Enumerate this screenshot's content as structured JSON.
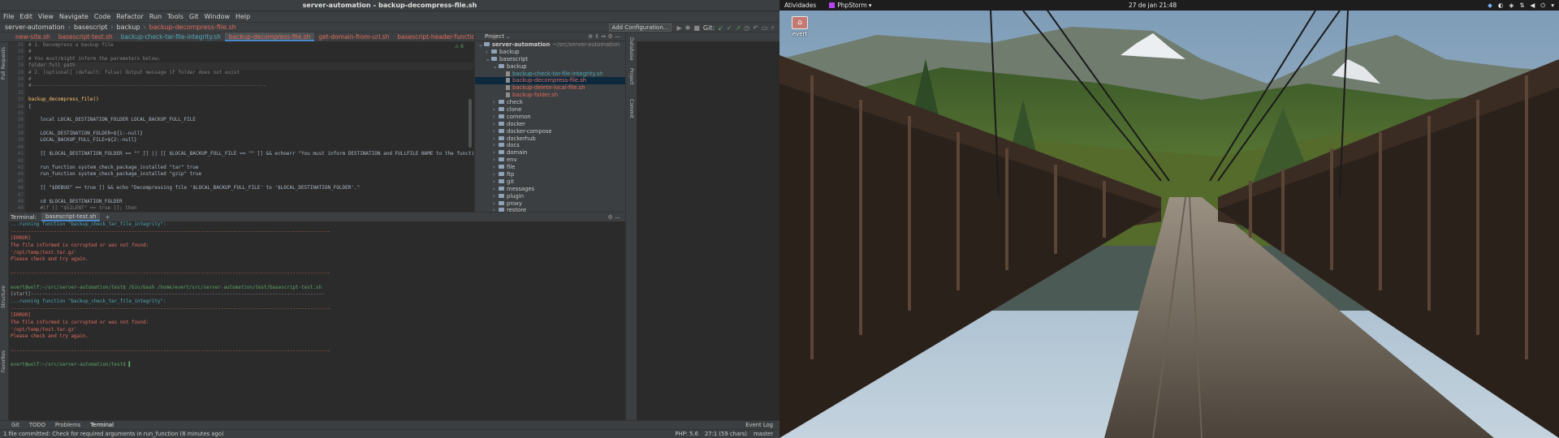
{
  "ide": {
    "title": "server-automation – backup-decompress-file.sh",
    "menu": [
      "File",
      "Edit",
      "View",
      "Navigate",
      "Code",
      "Refactor",
      "Run",
      "Tools",
      "Git",
      "Window",
      "Help"
    ],
    "breadcrumbs": [
      "server-automation",
      "basescript",
      "backup",
      "backup-decompress-file.sh"
    ],
    "add_configuration": "Add Configuration...",
    "git_label": "Git:",
    "tabs": [
      "new-site.sh",
      "basescript-test.sh",
      "backup-check-tar-file-integrity.sh",
      "backup-decompress-file.sh",
      "get-domain-from-url.sh",
      "basescript-header-function",
      "check-folder-e"
    ],
    "editor": {
      "warn": "⚠ 6",
      "line_numbers": [
        "25",
        "26",
        "27",
        "28",
        "29",
        "30",
        "31",
        "32",
        "33",
        "34",
        "35",
        "36",
        "37",
        "38",
        "39",
        "40",
        "41",
        "42",
        "43",
        "44",
        "45",
        "46",
        "47",
        "48",
        "49"
      ],
      "lines": [
        "# 1. Decompress a backup file",
        "#",
        "# You must/might inform the parameters below:",
        "folder full path",
        "# 2. [optional] (default: false) Output message if folder does not exist",
        "#",
        "#--------------------------------------------------------------------------------",
        "",
        "backup_decompress_file()",
        "{",
        "",
        "    local LOCAL_DESTINATION_FOLDER LOCAL_BACKUP_FULL_FILE",
        "",
        "    LOCAL_DESTINATION_FOLDER=${1:-null}",
        "    LOCAL_BACKUP_FULL_FILE=${2:-null}",
        "",
        "    [[ $LOCAL_DESTINATION_FOLDER == \"\" ]] || [[ $LOCAL_BACKUP_FULL_FILE == \"\" ]] && echoerr \"You must inform DESTINATION and FULLFILE NAME to the function: '${FUNCNAME[0]}'\"",
        "",
        "    run_function system_check_package_installed \"tar\" true",
        "    run_function system_check_package_installed \"gzip\" true",
        "",
        "    [[ \"$DEBUG\" == true ]] && echo \"Decompressing file '$LOCAL_BACKUP_FULL_FILE' to '$LOCAL_DESTINATION_FOLDER'.\"",
        "",
        "    cd $LOCAL_DESTINATION_FOLDER",
        "    #if [[ \"$SILENT\" == true ]]; then"
      ]
    },
    "project": {
      "title": "Project",
      "tree": [
        {
          "label": "server-automation",
          "path": "~/src/server-automation",
          "type": "root"
        },
        {
          "label": "backup",
          "type": "folder",
          "depth": 1
        },
        {
          "label": "basescript",
          "type": "folder-open",
          "depth": 1
        },
        {
          "label": "backup",
          "type": "folder-open",
          "depth": 2
        },
        {
          "label": "backup-check-tar-file-integrity.sh",
          "type": "file-teal",
          "depth": 3
        },
        {
          "label": "backup-decompress-file.sh",
          "type": "file-red-sel",
          "depth": 3
        },
        {
          "label": "backup-delete-local-file.sh",
          "type": "file-red",
          "depth": 3
        },
        {
          "label": "backup-folder.sh",
          "type": "file-red",
          "depth": 3
        },
        {
          "label": "check",
          "type": "folder",
          "depth": 2
        },
        {
          "label": "clone",
          "type": "folder",
          "depth": 2
        },
        {
          "label": "common",
          "type": "folder",
          "depth": 2
        },
        {
          "label": "docker",
          "type": "folder",
          "depth": 2
        },
        {
          "label": "docker-compose",
          "type": "folder",
          "depth": 2
        },
        {
          "label": "dockerhub",
          "type": "folder",
          "depth": 2
        },
        {
          "label": "docs",
          "type": "folder",
          "depth": 2
        },
        {
          "label": "domain",
          "type": "folder",
          "depth": 2
        },
        {
          "label": "env",
          "type": "folder",
          "depth": 2
        },
        {
          "label": "file",
          "type": "folder",
          "depth": 2
        },
        {
          "label": "ftp",
          "type": "folder",
          "depth": 2
        },
        {
          "label": "git",
          "type": "folder",
          "depth": 2
        },
        {
          "label": "messages",
          "type": "folder",
          "depth": 2
        },
        {
          "label": "plugin",
          "type": "folder",
          "depth": 2
        },
        {
          "label": "proxy",
          "type": "folder",
          "depth": 2
        },
        {
          "label": "restore",
          "type": "folder",
          "depth": 2
        }
      ]
    },
    "left_strip": [
      "Pull Requests",
      "Structure",
      "Favorites"
    ],
    "right_strip": [
      "Database",
      "Project",
      "Commit"
    ],
    "terminal": {
      "label": "Terminal:",
      "tab": "basescript-test.sh",
      "plus": "+",
      "lines": [
        {
          "t": "...running function \"backup_check_tar_file_integrity\":",
          "c": "t-blue"
        },
        {
          "t": "---------------------------------------------------------------------------------------------------------------",
          "c": "t-red"
        },
        {
          "t": "[ERROR]",
          "c": "t-red"
        },
        {
          "t": "The file informed is corrupted or was not found:",
          "c": "t-red"
        },
        {
          "t": "'/opt/temp/test.tar.gz'",
          "c": "t-red"
        },
        {
          "t": "Please check and try again.",
          "c": "t-red"
        },
        {
          "t": "",
          "c": "t-red"
        },
        {
          "t": "---------------------------------------------------------------------------------------------------------------",
          "c": "t-red"
        },
        {
          "t": "",
          "c": "t-white"
        },
        {
          "t": "evert@wolf:~/src/server-automation/test$ /bin/bash /home/evert/src/server-automation/test/basescript-test.sh",
          "c": "t-green"
        },
        {
          "t": "[start]------------------------------------------------------------------------------------------------------",
          "c": "t-grey"
        },
        {
          "t": "...running function \"backup_check_tar_file_integrity\":",
          "c": "t-blue"
        },
        {
          "t": "---------------------------------------------------------------------------------------------------------------",
          "c": "t-red"
        },
        {
          "t": "[ERROR]",
          "c": "t-red"
        },
        {
          "t": "The file informed is corrupted or was not found:",
          "c": "t-red"
        },
        {
          "t": "'/opt/temp/test.tar.gz'",
          "c": "t-red"
        },
        {
          "t": "Please check and try again.",
          "c": "t-red"
        },
        {
          "t": "",
          "c": "t-red"
        },
        {
          "t": "---------------------------------------------------------------------------------------------------------------",
          "c": "t-red"
        },
        {
          "t": "",
          "c": "t-white"
        },
        {
          "t": "evert@wolf:~/src/server-automation/test$ ▌",
          "c": "t-green"
        }
      ]
    },
    "toolwindows": [
      "Git",
      "TODO",
      "Problems",
      "Terminal"
    ],
    "event_log": "Event Log",
    "status": {
      "message": "1 file committed: Check for required arguments in run_function (8 minutes ago)",
      "php": "PHP: 5.6",
      "position": "27:1 (59 chars)",
      "branch": "master"
    }
  },
  "desktop": {
    "activities": "Atividades",
    "app": "PhpStorm",
    "clock": "27 de jan  21:48",
    "icon_label": "evert"
  }
}
